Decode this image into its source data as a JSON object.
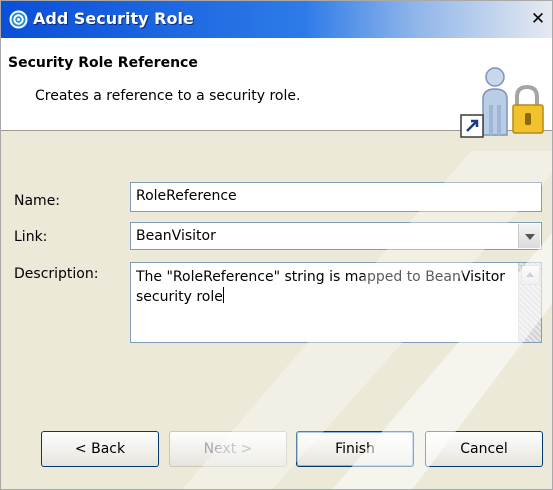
{
  "window": {
    "title": "Add Security Role",
    "close_glyph": "✕"
  },
  "banner": {
    "title": "Security Role Reference",
    "description": "Creates a reference to a security role.",
    "art_icon": "security-role-lock-icon"
  },
  "form": {
    "name_label": "Name:",
    "name_value": "RoleReference",
    "link_label": "Link:",
    "link_value": "BeanVisitor",
    "description_label": "Description:",
    "description_value": "The \"RoleReference\" string is mapped to BeanVisitor security role"
  },
  "buttons": {
    "back": "< Back",
    "next": "Next >",
    "finish": "Finish",
    "cancel": "Cancel"
  },
  "colors": {
    "titlebar": "#0a4fd8",
    "dialog_bg": "#ece9d8",
    "field_border": "#7f9db9"
  }
}
